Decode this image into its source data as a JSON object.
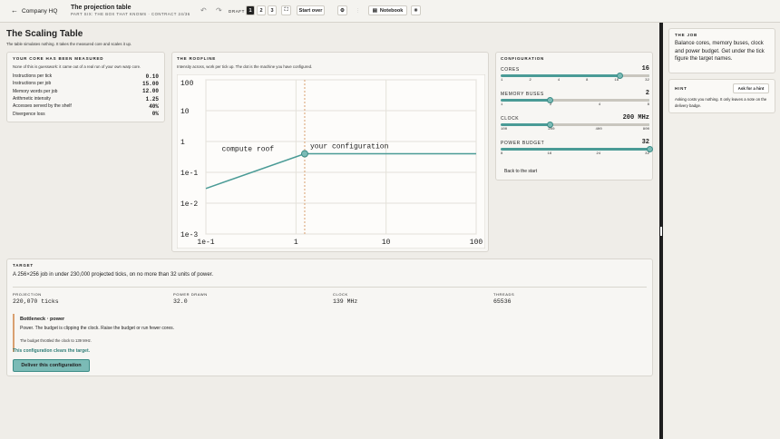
{
  "topbar": {
    "back_label": "Company HQ",
    "title": "The projection table",
    "subtitle": "PART SIX: THE BOX THAT KNOWS · CONTRACT 24/36",
    "draft_label": "DRAFT",
    "drafts": [
      "1",
      "2",
      "3"
    ],
    "start_over": "Start over",
    "notebook": "Notebook"
  },
  "page": {
    "title": "The Scaling Table",
    "lede": "The table simulates nothing. It takes the measured core and scales it up."
  },
  "core": {
    "caption": "YOUR CORE HAS BEEN MEASURED",
    "note": "None of this is guesswork: it came out of a real run of your own warp core.",
    "rows": [
      {
        "label": "Instructions per tick",
        "value": "0.10"
      },
      {
        "label": "Instructions per job",
        "value": "15.00"
      },
      {
        "label": "Memory words per job",
        "value": "12.00"
      },
      {
        "label": "Arithmetic intensity",
        "value": "1.25"
      },
      {
        "label": "Accesses served by the shelf",
        "value": "40%"
      },
      {
        "label": "Divergence loss",
        "value": "0%"
      }
    ]
  },
  "roofline": {
    "caption": "THE ROOFLINE",
    "note": "Intensity across, work per tick up. The dot is the machine you have configured."
  },
  "chart_data": {
    "type": "line",
    "x_scale": "log",
    "y_scale": "log",
    "xlim": [
      0.1,
      100
    ],
    "ylim": [
      0.001,
      100
    ],
    "x_ticks": [
      "1e-1",
      "1",
      "10",
      "100"
    ],
    "y_ticks": [
      "100",
      "10",
      "1",
      "1e-1",
      "1e-2",
      "1e-3"
    ],
    "roof_series": {
      "x": [
        0.1,
        1.25,
        100
      ],
      "y": [
        0.03,
        0.4,
        0.4
      ]
    },
    "marked_intensity": 1.25,
    "point": {
      "x": 1.25,
      "y": 0.4,
      "label": "your configuration"
    },
    "roof_label": "compute roof",
    "colors": {
      "roof": "#4a9b96",
      "guide": "#d9a070",
      "point": "#7bbbb6"
    }
  },
  "config": {
    "caption": "CONFIGURATION",
    "sliders": [
      {
        "label": "CORES",
        "value": "16",
        "fraction": 0.8,
        "ticks": [
          "1",
          "2",
          "4",
          "8",
          "16",
          "32"
        ]
      },
      {
        "label": "MEMORY BUSES",
        "value": "2",
        "fraction": 0.33,
        "ticks": [
          "1",
          "2",
          "4",
          "8"
        ]
      },
      {
        "label": "CLOCK",
        "value": "200 MHz",
        "fraction": 0.33,
        "ticks": [
          "100",
          "200",
          "400",
          "800"
        ]
      },
      {
        "label": "POWER BUDGET",
        "value": "32",
        "fraction": 1.0,
        "ticks": [
          "8",
          "16",
          "24",
          "32"
        ]
      }
    ],
    "back": "Back to the start"
  },
  "target": {
    "caption": "TARGET",
    "text": "A 256×256 job in under 230,000 projected ticks, on no more than 32 units of power.",
    "stats": [
      {
        "label": "PROJECTION",
        "value": "220,070 ticks"
      },
      {
        "label": "POWER DRAWN",
        "value": "32.0"
      },
      {
        "label": "CLOCK",
        "value": "139 MHz"
      },
      {
        "label": "THREADS",
        "value": "65536"
      }
    ],
    "bottleneck_title": "Bottleneck · power",
    "bottleneck_text": "Power. The budget is clipping the clock. Raise the budget or run fewer cores.",
    "throttle_note": "The budget throttled the clock to 139 MHz.",
    "status": "This configuration clears the target.",
    "deliver": "Deliver this configuration"
  },
  "job": {
    "caption": "THE JOB",
    "text": "Balance cores, memory buses, clock and power budget. Get under the tick figure the target names."
  },
  "hint": {
    "caption": "HINT",
    "button": "Ask for a hint",
    "text": "Asking costs you nothing. It only leaves a note on the delivery badge."
  }
}
